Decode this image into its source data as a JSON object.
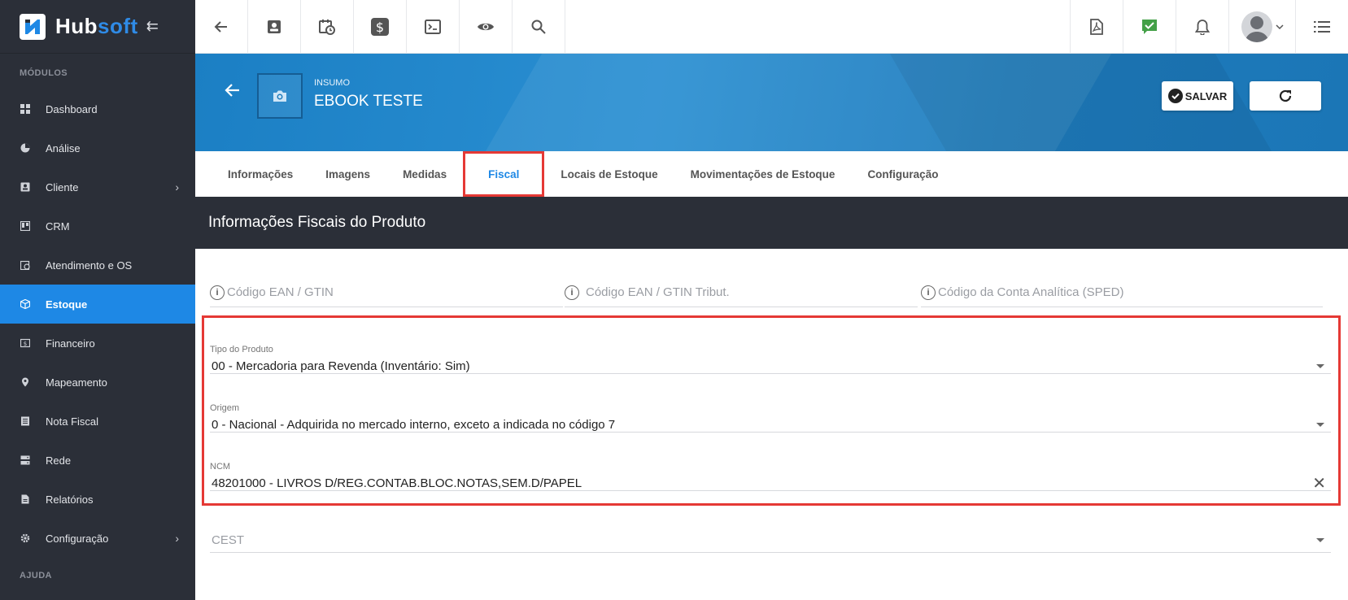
{
  "brand": {
    "name_part1": "Hub",
    "name_part2": "soft",
    "collapse_glyph": "⇇"
  },
  "sidebar": {
    "section_modules": "MÓDULOS",
    "items": [
      {
        "label": "Dashboard",
        "icon": "dashboard-icon"
      },
      {
        "label": "Análise",
        "icon": "pie-chart-icon"
      },
      {
        "label": "Cliente",
        "icon": "contact-card-icon",
        "has_submenu": true
      },
      {
        "label": "CRM",
        "icon": "kanban-icon"
      },
      {
        "label": "Atendimento e OS",
        "icon": "calendar-clock-icon"
      },
      {
        "label": "Estoque",
        "icon": "box-icon",
        "active": true
      },
      {
        "label": "Financeiro",
        "icon": "money-icon"
      },
      {
        "label": "Mapeamento",
        "icon": "map-pin-icon"
      },
      {
        "label": "Nota Fiscal",
        "icon": "receipt-icon"
      },
      {
        "label": "Rede",
        "icon": "server-icon"
      },
      {
        "label": "Relatórios",
        "icon": "document-icon"
      },
      {
        "label": "Configuração",
        "icon": "gear-icon",
        "has_submenu": true
      }
    ],
    "section_help": "AJUDA",
    "submenu_glyph": "›"
  },
  "topbar": {
    "left_icons": [
      "back-arrow-icon",
      "contact-card-icon",
      "calendar-clock-icon",
      "dollar-icon",
      "terminal-icon",
      "eye-icon",
      "search-icon"
    ],
    "right_icons": [
      "pdf-icon",
      "checked-message-icon",
      "bell-icon",
      "user-avatar",
      "list-icon"
    ]
  },
  "header": {
    "kind": "INSUMO",
    "product_name": "EBOOK TESTE",
    "save_label": "SALVAR"
  },
  "tabs": [
    {
      "label": "Informações"
    },
    {
      "label": "Imagens"
    },
    {
      "label": "Medidas"
    },
    {
      "label": "Fiscal",
      "active": true
    },
    {
      "label": "Locais de Estoque"
    },
    {
      "label": "Movimentações de Estoque"
    },
    {
      "label": "Configuração"
    }
  ],
  "section_title": "Informações Fiscais do Produto",
  "form": {
    "ean_placeholder": "Código EAN / GTIN",
    "ean_tribut_placeholder": "Código EAN / GTIN Tribut.",
    "sped_placeholder": "Código da Conta Analítica (SPED)",
    "info_glyph": "i",
    "tipo_produto": {
      "label": "Tipo do Produto",
      "value": "00 - Mercadoria para Revenda (Inventário: Sim)"
    },
    "origem": {
      "label": "Origem",
      "value": "0 - Nacional - Adquirida no mercado interno, exceto a indicada no código 7"
    },
    "ncm": {
      "label": "NCM",
      "value": "48201000 - LIVROS D/REG.CONTAB.BLOC.NOTAS,SEM.D/PAPEL",
      "clear_glyph": "✕"
    },
    "cest_placeholder": "CEST"
  },
  "colors": {
    "accent": "#1e88e5",
    "sidebar_bg": "#2b2f38",
    "highlight": "#e53935",
    "banner": "#2a8fd2"
  }
}
